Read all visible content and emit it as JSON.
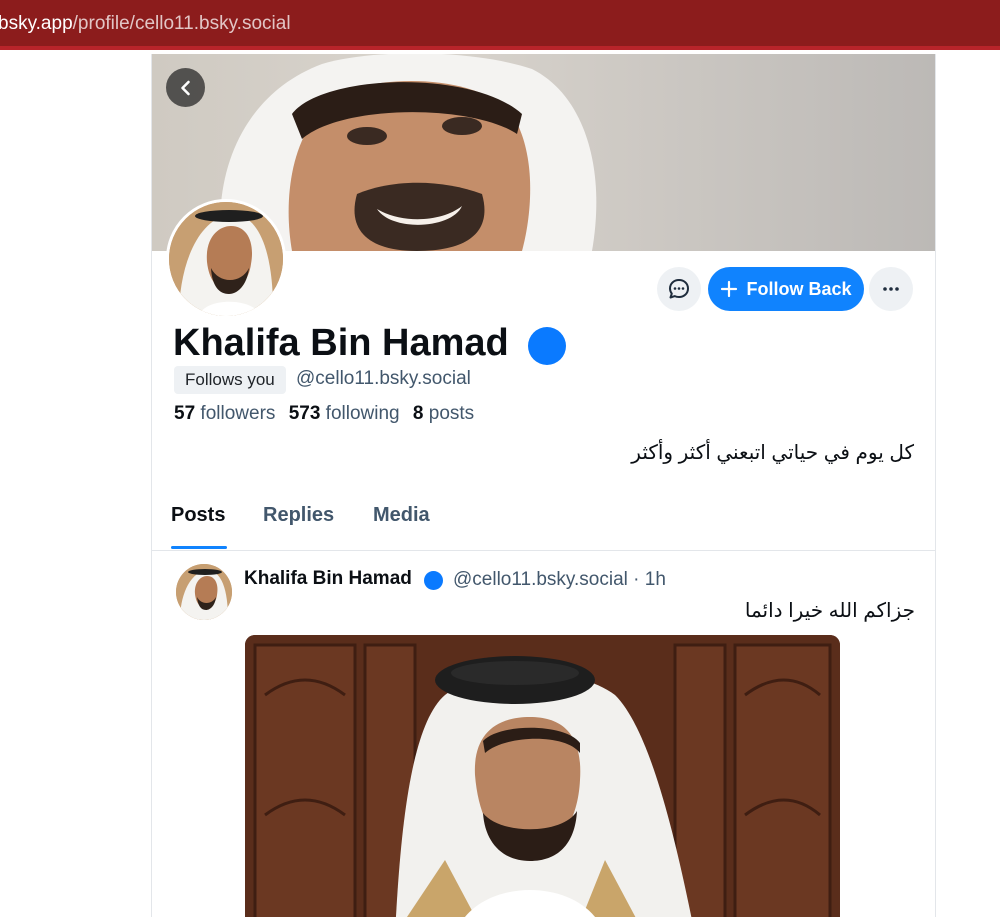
{
  "browser": {
    "url_host": "bsky.app",
    "url_path": "/profile/cello11.bsky.social"
  },
  "profile": {
    "display_name": "Khalifa Bin Hamad",
    "follows_you_label": "Follows you",
    "handle": "@cello11.bsky.social",
    "followers_count": "57",
    "followers_label": "followers",
    "following_count": "573",
    "following_label": "following",
    "posts_count": "8",
    "posts_label": "posts",
    "bio": "كل يوم في حياتي اتبعني أكثر وأكثر"
  },
  "actions": {
    "follow_back_label": "Follow Back"
  },
  "tabs": [
    {
      "label": "Posts",
      "active": true
    },
    {
      "label": "Replies",
      "active": false
    },
    {
      "label": "Media",
      "active": false
    }
  ],
  "post": {
    "author_name": "Khalifa Bin Hamad",
    "meta": "@cello11.bsky.social · 1h",
    "text": "جزاكم الله خيرا دائما"
  },
  "colors": {
    "accent": "#1083fe",
    "verified": "#0a7aff",
    "browser_bar": "#8c1c1c"
  },
  "icons": [
    "back-arrow-icon",
    "chat-icon",
    "plus-icon",
    "more-horizontal-icon",
    "verified-badge-icon"
  ]
}
